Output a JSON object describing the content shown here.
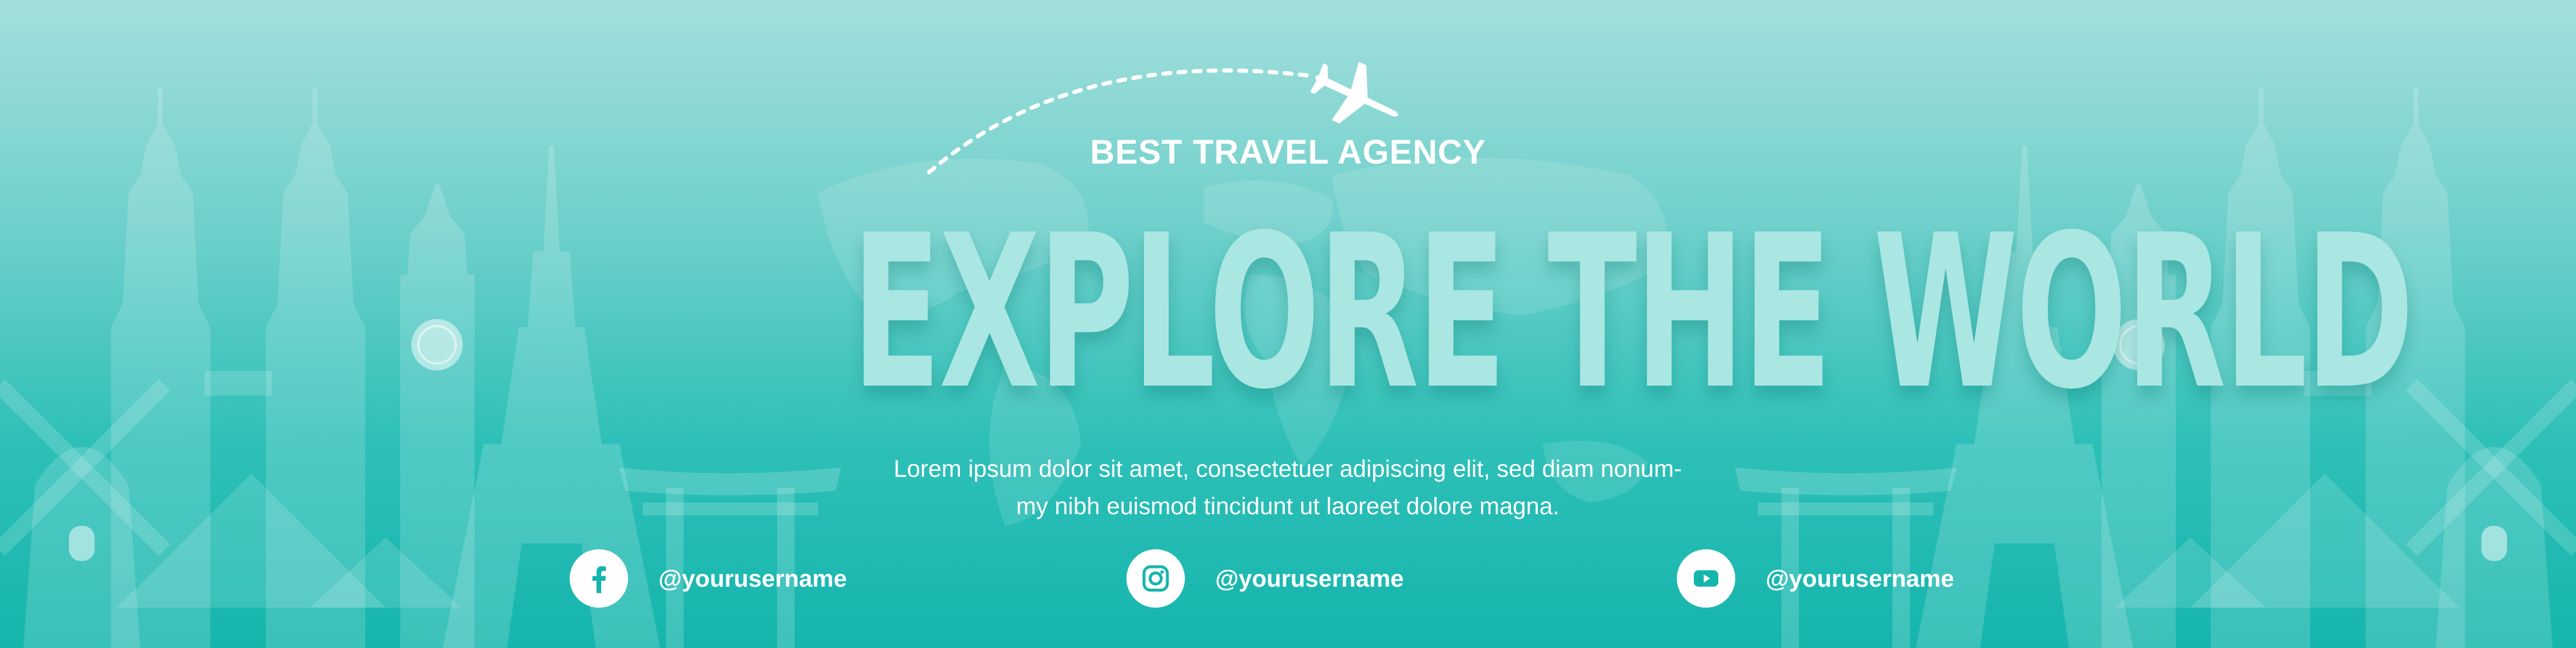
{
  "brand": {
    "tagline": "BEST TRAVEL AGENCY",
    "headline": "EXPLORE THE WORLD"
  },
  "description": {
    "line1": "Lorem ipsum dolor sit amet, consectetuer adipiscing elit, sed diam nonum-",
    "line2": "my nibh euismod tincidunt ut laoreet dolore magna."
  },
  "socials": [
    {
      "network": "facebook",
      "icon": "facebook-icon",
      "handle": "@yourusername"
    },
    {
      "network": "instagram",
      "icon": "instagram-icon",
      "handle": "@yourusername"
    },
    {
      "network": "youtube",
      "icon": "youtube-icon",
      "handle": "@yourusername"
    }
  ],
  "colors": {
    "background_top": "#a4dfdc",
    "background_bottom": "#15b5ad",
    "landmark_silhouette": "#ffffff",
    "headline": "#aae6e2",
    "text": "#ffffff",
    "icon_glyph": "#14b5ad"
  }
}
